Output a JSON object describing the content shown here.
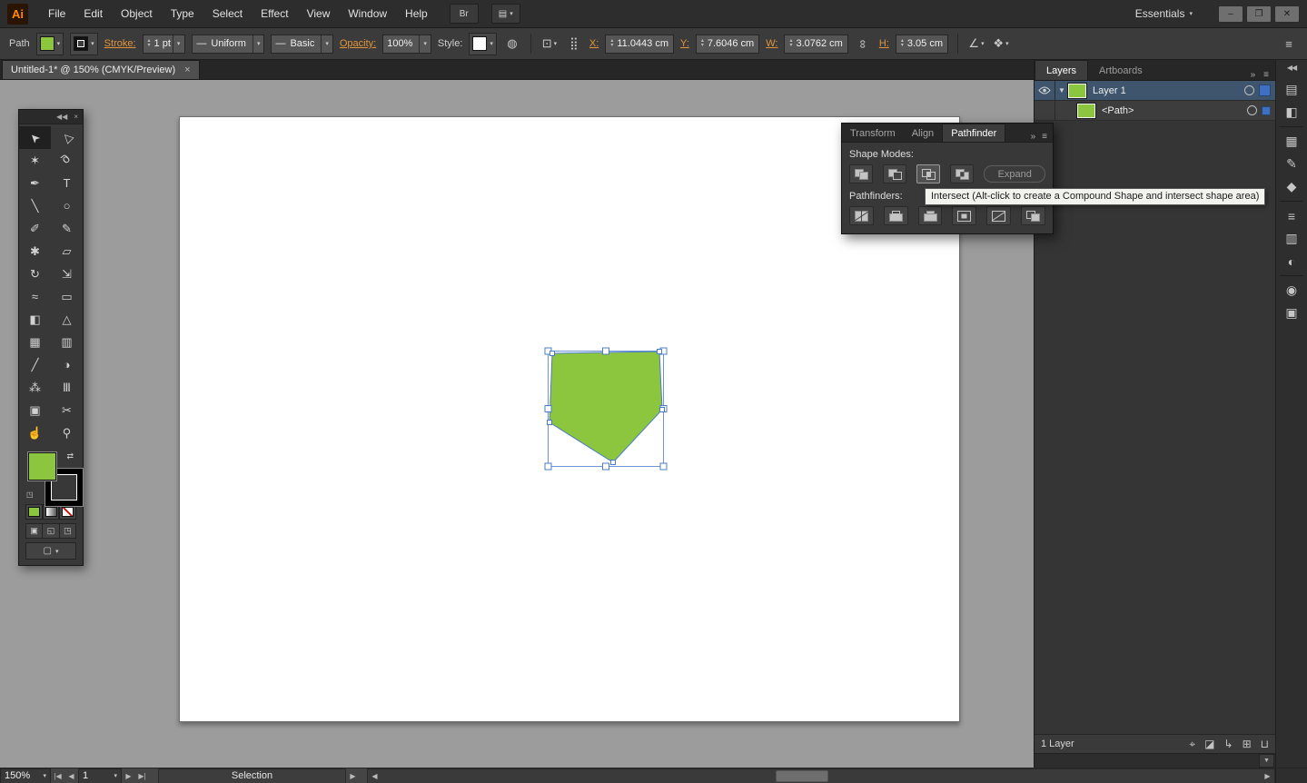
{
  "menubar": {
    "logo": "Ai",
    "items": [
      "File",
      "Edit",
      "Object",
      "Type",
      "Select",
      "Effect",
      "View",
      "Window",
      "Help"
    ],
    "bridge_icon_label": "Br",
    "workspace_label": "Essentials"
  },
  "controlbar": {
    "path_label": "Path",
    "stroke_link": "Stroke:",
    "stroke_weight": "1 pt",
    "variable_width": "Uniform",
    "brush": "Basic",
    "opacity_link": "Opacity:",
    "opacity_value": "100%",
    "style_label": "Style:",
    "x_label": "X:",
    "x_value": "11.0443 cm",
    "y_label": "Y:",
    "y_value": "7.6046 cm",
    "w_label": "W:",
    "w_value": "3.0762 cm",
    "h_label": "H:",
    "h_value": "3.05 cm"
  },
  "doc_tab": {
    "title": "Untitled-1* @ 150% (CMYK/Preview)"
  },
  "toolbar": {
    "tools": [
      {
        "name": "selection",
        "glyph": "➤"
      },
      {
        "name": "direct-selection",
        "glyph": "▷"
      },
      {
        "name": "magic-wand",
        "glyph": "✶"
      },
      {
        "name": "lasso",
        "glyph": "ϱ"
      },
      {
        "name": "pen",
        "glyph": "✒"
      },
      {
        "name": "type",
        "glyph": "T"
      },
      {
        "name": "line-segment",
        "glyph": "╲"
      },
      {
        "name": "ellipse",
        "glyph": "○"
      },
      {
        "name": "paintbrush",
        "glyph": "✐"
      },
      {
        "name": "pencil",
        "glyph": "✎"
      },
      {
        "name": "blob-brush",
        "glyph": "✱"
      },
      {
        "name": "eraser",
        "glyph": "▱"
      },
      {
        "name": "rotate",
        "glyph": "↻"
      },
      {
        "name": "scale",
        "glyph": "⇲"
      },
      {
        "name": "width",
        "glyph": "≈"
      },
      {
        "name": "free-transform",
        "glyph": "▭"
      },
      {
        "name": "shape-builder",
        "glyph": "◧"
      },
      {
        "name": "perspective-grid",
        "glyph": "△"
      },
      {
        "name": "mesh",
        "glyph": "▦"
      },
      {
        "name": "gradient",
        "glyph": "▥"
      },
      {
        "name": "eyedropper",
        "glyph": "╱"
      },
      {
        "name": "blend",
        "glyph": "◑"
      },
      {
        "name": "symbol-sprayer",
        "glyph": "⁂"
      },
      {
        "name": "column-graph",
        "glyph": "Ⅲ"
      },
      {
        "name": "artboard",
        "glyph": "▣"
      },
      {
        "name": "slice",
        "glyph": "✂"
      },
      {
        "name": "hand",
        "glyph": "☝"
      },
      {
        "name": "zoom",
        "glyph": "⚲"
      }
    ]
  },
  "pathfinder": {
    "tabs": [
      "Transform",
      "Align",
      "Pathfinder"
    ],
    "active_tab": "Pathfinder",
    "shape_modes_label": "Shape Modes:",
    "pathfinders_label": "Pathfinders:",
    "expand_button": "Expand",
    "shape_modes": [
      "unite",
      "minus-front",
      "intersect",
      "exclude"
    ],
    "pathfinders": [
      "divide",
      "trim",
      "merge",
      "crop",
      "outline",
      "minus-back"
    ],
    "tooltip": "Intersect (Alt-click to create a Compound Shape and intersect shape area)"
  },
  "layers": {
    "tabs": [
      "Layers",
      "Artboards"
    ],
    "rows": [
      {
        "label": "Layer 1"
      },
      {
        "label": "<Path>"
      }
    ],
    "footer": "1 Layer"
  },
  "right_strip": {
    "icons": [
      {
        "name": "color",
        "glyph": "▤"
      },
      {
        "name": "color-guide",
        "glyph": "◧"
      },
      {
        "name": "swatches",
        "glyph": "▦"
      },
      {
        "name": "brushes",
        "glyph": "✎"
      },
      {
        "name": "symbols",
        "glyph": "◆"
      },
      {
        "name": "stroke",
        "glyph": "≡"
      },
      {
        "name": "gradient",
        "glyph": "▥"
      },
      {
        "name": "transparency",
        "glyph": "◐"
      },
      {
        "name": "appearance",
        "glyph": "◉"
      },
      {
        "name": "graphic-styles",
        "glyph": "▣"
      }
    ]
  },
  "layers_footer_icons": [
    {
      "name": "locate-object",
      "glyph": "⌖"
    },
    {
      "name": "clipping-mask",
      "glyph": "◪"
    },
    {
      "name": "new-sublayer",
      "glyph": "↳"
    },
    {
      "name": "new-layer",
      "glyph": "⊞"
    },
    {
      "name": "delete",
      "glyph": "⊔"
    }
  ],
  "statusbar": {
    "zoom": "150%",
    "page": "1",
    "mode": "Selection"
  },
  "ui": {
    "dd": "▾",
    "up": "▴",
    "down": "▾",
    "left": "◀",
    "right": "▶",
    "first": "|◀",
    "last": "▶|",
    "close": "×",
    "win_min": "–",
    "win_restore": "❐",
    "win_close": "✕",
    "collapse_left": "◀◀",
    "double_chevron": "»",
    "menu": "≡",
    "scroll_down": "▼",
    "line_preview": "—",
    "link": "∞",
    "swap": "⇄",
    "grid9": "⣿",
    "recolor": "◍",
    "select_similar": "⊡",
    "shear": "∠",
    "transform_each": "❖",
    "dm_normal": "▣",
    "dm_behind": "◱",
    "dm_inside": "◳",
    "screen_mode": "▢"
  },
  "colors": {
    "shape_green": "#8CC63F",
    "selection_blue": "#4A7CC9",
    "layer_selected_row": "#3F556D",
    "link_orange": "#E0953C"
  }
}
